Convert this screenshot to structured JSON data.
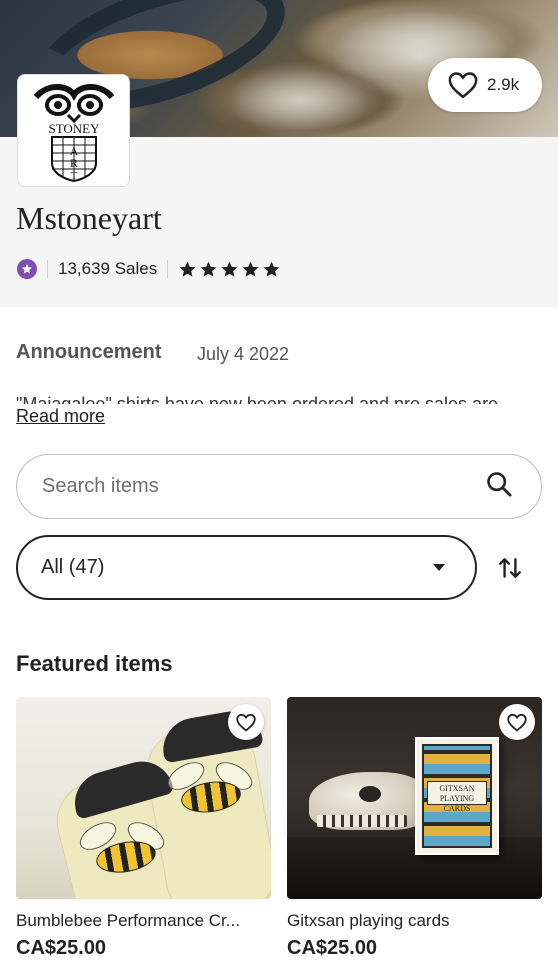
{
  "shop": {
    "favorites_count": "2.9k",
    "name": "Mstoneyart",
    "sales": "13,639 Sales",
    "rating_stars": 5
  },
  "announcement": {
    "title": "Announcement",
    "date": "July 4 2022",
    "body": "\"Majagalee\" shirts have now been ordered and pre sales are",
    "read_more": "Read more"
  },
  "search": {
    "placeholder": "Search items"
  },
  "filter": {
    "selected": "All (47)"
  },
  "featured": {
    "title": "Featured items",
    "items": [
      {
        "title": "Bumblebee Performance Cr...",
        "price": "CA$25.00"
      },
      {
        "title": "Gitxsan playing cards",
        "price": "CA$25.00"
      }
    ]
  },
  "logo": {
    "text": "STONEY ART"
  },
  "deck_label": "GITXSAN PLAYING CARDS",
  "colors": {
    "star_seller": "#7d4fb3",
    "text": "#222222",
    "muted": "#555555"
  },
  "icons": [
    "heart-icon",
    "star-seller-icon",
    "star-icon",
    "search-icon",
    "caret-down-icon",
    "sort-icon"
  ]
}
